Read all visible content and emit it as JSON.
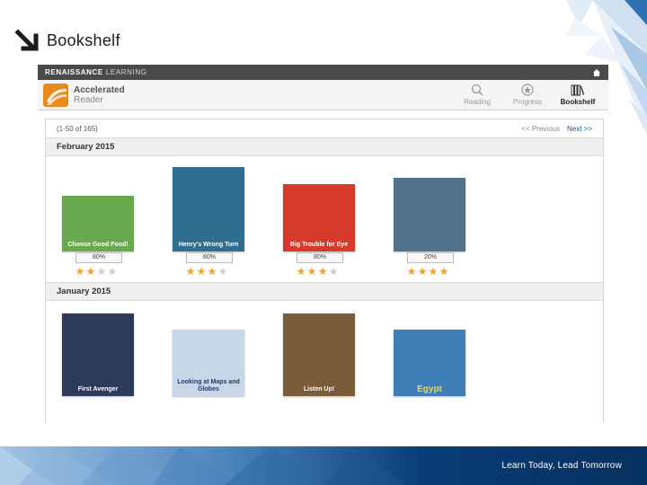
{
  "slide": {
    "title": "Bookshelf",
    "tagline": "Learn Today, Lead Tomorrow"
  },
  "app": {
    "brand": "RENAISSANCE",
    "brand_sub": "LEARNING",
    "product_title": "Accelerated",
    "product_sub": "Reader",
    "nav": [
      {
        "label": "Reading",
        "icon": "search-icon",
        "active": false
      },
      {
        "label": "Progress",
        "icon": "star-badge-icon",
        "active": false
      },
      {
        "label": "Bookshelf",
        "icon": "bookshelf-icon",
        "active": true
      }
    ]
  },
  "pager": {
    "count": "(1-50 of 165)",
    "previous": "<< Previous",
    "next": "Next >>"
  },
  "sections": [
    {
      "month": "February 2015",
      "books": [
        {
          "title": "Choose Good Food!",
          "quiz": "80%",
          "stars": 2,
          "color": "#6aa84f"
        },
        {
          "title": "Henry's Wrong Turn",
          "quiz": "80%",
          "stars": 3,
          "color": "#2f6e8f"
        },
        {
          "title": "Big Trouble for Eye",
          "quiz": "80%",
          "stars": 3,
          "color": "#d63a2a"
        },
        {
          "title": "",
          "quiz": "20%",
          "stars": 4,
          "color": "#51728c"
        }
      ]
    },
    {
      "month": "January 2015",
      "books": [
        {
          "title": "First Avenger",
          "color": "#2d3a5c"
        },
        {
          "title": "Looking at Maps and Globes",
          "color": "#c9d6e8"
        },
        {
          "title": "Listen Up!",
          "color": "#7a5c3a"
        },
        {
          "title": "Egypt",
          "color": "#3f7fb8"
        }
      ]
    }
  ],
  "colors": {
    "accent_orange": "#e98a1f",
    "star_gold": "#f0a52b",
    "star_empty": "#cfcfcf",
    "link_blue": "#1a4fa0",
    "footer_navy": "#0a3d78"
  }
}
